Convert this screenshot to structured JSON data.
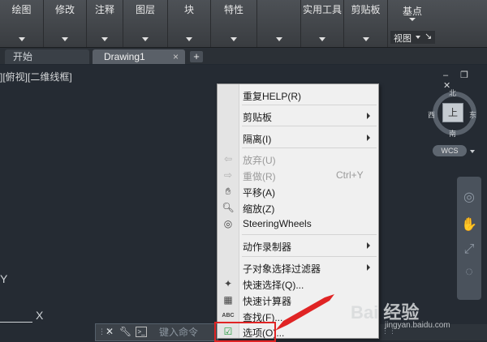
{
  "ribbon": {
    "panels": [
      {
        "label": "绘图"
      },
      {
        "label": "修改"
      },
      {
        "label": "注释"
      },
      {
        "label": "图层"
      },
      {
        "label": "块"
      },
      {
        "label": "特性"
      },
      {
        "label": ""
      },
      {
        "label": "实用工具"
      },
      {
        "label": "剪贴板"
      },
      {
        "label": "基点"
      }
    ],
    "view_label": "视图",
    "view_launcher": "↘"
  },
  "tabs": {
    "start": "开始",
    "drawing": "Drawing1",
    "close": "×",
    "add": "+"
  },
  "viewport": {
    "label": "][俯视][二维线框]",
    "win_controls": "‒ ❐ ✕",
    "viewcube": {
      "top": "上",
      "north": "北",
      "south": "南",
      "west": "西",
      "east": "东",
      "wcs": "WCS"
    },
    "ucs": {
      "y": "Y",
      "x": "X"
    }
  },
  "command_line": {
    "close": "✕",
    "placeholder": "键入命令"
  },
  "context_menu": {
    "items": [
      {
        "label": "重复HELP(R)"
      },
      {
        "label": "剪贴板"
      },
      {
        "label": "隔离(I)"
      },
      {
        "label": "放弃(U)"
      },
      {
        "label": "重做(R)",
        "shortcut": "Ctrl+Y"
      },
      {
        "label": "平移(A)"
      },
      {
        "label": "缩放(Z)"
      },
      {
        "label": "SteeringWheels"
      },
      {
        "label": "动作录制器"
      },
      {
        "label": "子对象选择过滤器"
      },
      {
        "label": "快速选择(Q)..."
      },
      {
        "label": "快速计算器"
      },
      {
        "label": "查找(F)..."
      },
      {
        "label": "选项(O)..."
      }
    ],
    "find_icon_text": "ABC"
  },
  "watermark": {
    "text": "Bai 经验",
    "url": "jingyan.baidu.com"
  },
  "colors": {
    "highlight": "#e02424",
    "ribbon": "#45494e",
    "canvas": "#252b33",
    "menu": "#f0f0f0"
  }
}
